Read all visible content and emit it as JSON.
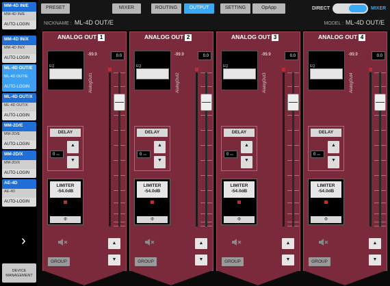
{
  "sidebar": {
    "devices": [
      {
        "name": "MM-4D IN/E",
        "sub": "MM-4D IN/E",
        "auto": "AUTO-LOGIN",
        "selected": false
      },
      {
        "name": "MM-4D IN/X",
        "sub": "MM-4D IN/X",
        "auto": "AUTO-LOGIN",
        "selected": false
      },
      {
        "name": "ML-4D OUT/E",
        "sub": "ML-4D OUT/E",
        "auto": "AUTO-LOGIN",
        "selected": true
      },
      {
        "name": "ML-4D OUT/X",
        "sub": "ML-4D OUT/X",
        "auto": "AUTO-LOGIN",
        "selected": false
      },
      {
        "name": "MM-2D/E",
        "sub": "MM-2D/E",
        "auto": "AUTO-LOGIN",
        "selected": false
      },
      {
        "name": "MM-2D/X",
        "sub": "MM-2D/X",
        "auto": "AUTO-LOGIN",
        "selected": false
      },
      {
        "name": "AE-4D",
        "sub": "AE-4D",
        "auto": "AUTO-LOGIN",
        "selected": false
      }
    ],
    "chevron": "›",
    "device_management": "DEVICE MANAGEMENT"
  },
  "header": {
    "tabs": [
      {
        "label": "PRESET",
        "active": false
      },
      {
        "label": "MIXER",
        "active": false
      },
      {
        "label": "ROUTING",
        "active": false
      },
      {
        "label": "OUTPUT",
        "active": true
      },
      {
        "label": "SETTING",
        "active": false
      },
      {
        "label": "OpApp",
        "active": false
      }
    ],
    "nickname_label": "NICKNAME :",
    "nickname": "ML-4D OUT/E",
    "direct_label": "DIRECT",
    "mixer_label": "MIXER",
    "model_label": "MODEL :",
    "model": "ML-4D OUT/E"
  },
  "channels": [
    {
      "title": "ANALOG OUT",
      "num": "1",
      "name": "AlalogOut1",
      "trim": "-99.9",
      "gain": "0.0",
      "gain_unit": "dB",
      "eq": "EQ",
      "delay_label": "DELAY",
      "delay_value": "0",
      "delay_unit": "ms",
      "limiter": "LIMITER",
      "limiter_value": "-54.0dB",
      "phase": "Φ",
      "group": "GROUP"
    },
    {
      "title": "ANALOG OUT",
      "num": "2",
      "name": "AlalogOut2",
      "trim": "-99.9",
      "gain": "0.0",
      "gain_unit": "dB",
      "eq": "EQ",
      "delay_label": "DELAY",
      "delay_value": "0",
      "delay_unit": "ms",
      "limiter": "LIMITER",
      "limiter_value": "-54.0dB",
      "phase": "Φ",
      "group": "GROUP"
    },
    {
      "title": "ANALOG OUT",
      "num": "3",
      "name": "AlalogOut3",
      "trim": "-99.9",
      "gain": "0.0",
      "gain_unit": "dB",
      "eq": "EQ",
      "delay_label": "DELAY",
      "delay_value": "0",
      "delay_unit": "ms",
      "limiter": "LIMITER",
      "limiter_value": "-54.0dB",
      "phase": "Φ",
      "group": "GROUP"
    },
    {
      "title": "ANALOG OUT",
      "num": "4",
      "name": "AlalogOut4",
      "trim": "-99.9",
      "gain": "0.0",
      "gain_unit": "dB",
      "eq": "EQ",
      "delay_label": "DELAY",
      "delay_value": "0",
      "delay_unit": "ms",
      "limiter": "LIMITER",
      "limiter_value": "-54.0dB",
      "phase": "Φ",
      "group": "GROUP"
    }
  ],
  "icons": {
    "up": "▲",
    "down": "▼",
    "mute": "speaker-muted-icon"
  },
  "colors": {
    "accent": "#37a9f5",
    "device_tab": "#1f6fd6",
    "strip": "#7a2a3a",
    "led": "#c82828"
  }
}
